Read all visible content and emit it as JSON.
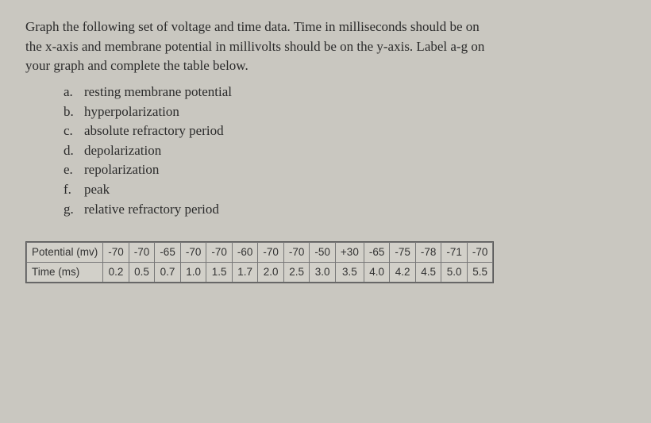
{
  "instruction_lines": [
    "Graph the following set of voltage and time data. Time in milliseconds should be on",
    "the x-axis and membrane potential in millivolts should be on the y-axis. Label a-g on",
    "your graph and complete the table below."
  ],
  "list": [
    {
      "marker": "a.",
      "text": "resting membrane potential"
    },
    {
      "marker": "b.",
      "text": "hyperpolarization"
    },
    {
      "marker": "c.",
      "text": "absolute refractory period"
    },
    {
      "marker": "d.",
      "text": "depolarization"
    },
    {
      "marker": "e.",
      "text": "repolarization"
    },
    {
      "marker": "f.",
      "text": "peak"
    },
    {
      "marker": "g.",
      "text": "relative refractory period"
    }
  ],
  "table": {
    "row1_label": "Potential (mv)",
    "row2_label": "Time (ms)",
    "potential": [
      "-70",
      "-70",
      "-65",
      "-70",
      "-70",
      "-60",
      "-70",
      "-70",
      "-50",
      "+30",
      "-65",
      "-75",
      "-78",
      "-71",
      "-70"
    ],
    "time": [
      "0.2",
      "0.5",
      "0.7",
      "1.0",
      "1.5",
      "1.7",
      "2.0",
      "2.5",
      "3.0",
      "3.5",
      "4.0",
      "4.2",
      "4.5",
      "5.0",
      "5.5"
    ]
  },
  "chart_data": {
    "type": "table",
    "title": "Voltage and time data",
    "xlabel": "Time (ms)",
    "ylabel": "Potential (mv)",
    "x": [
      0.2,
      0.5,
      0.7,
      1.0,
      1.5,
      1.7,
      2.0,
      2.5,
      3.0,
      3.5,
      4.0,
      4.2,
      4.5,
      5.0,
      5.5
    ],
    "y": [
      -70,
      -70,
      -65,
      -70,
      -70,
      -60,
      -70,
      -70,
      -50,
      30,
      -65,
      -75,
      -78,
      -71,
      -70
    ]
  }
}
